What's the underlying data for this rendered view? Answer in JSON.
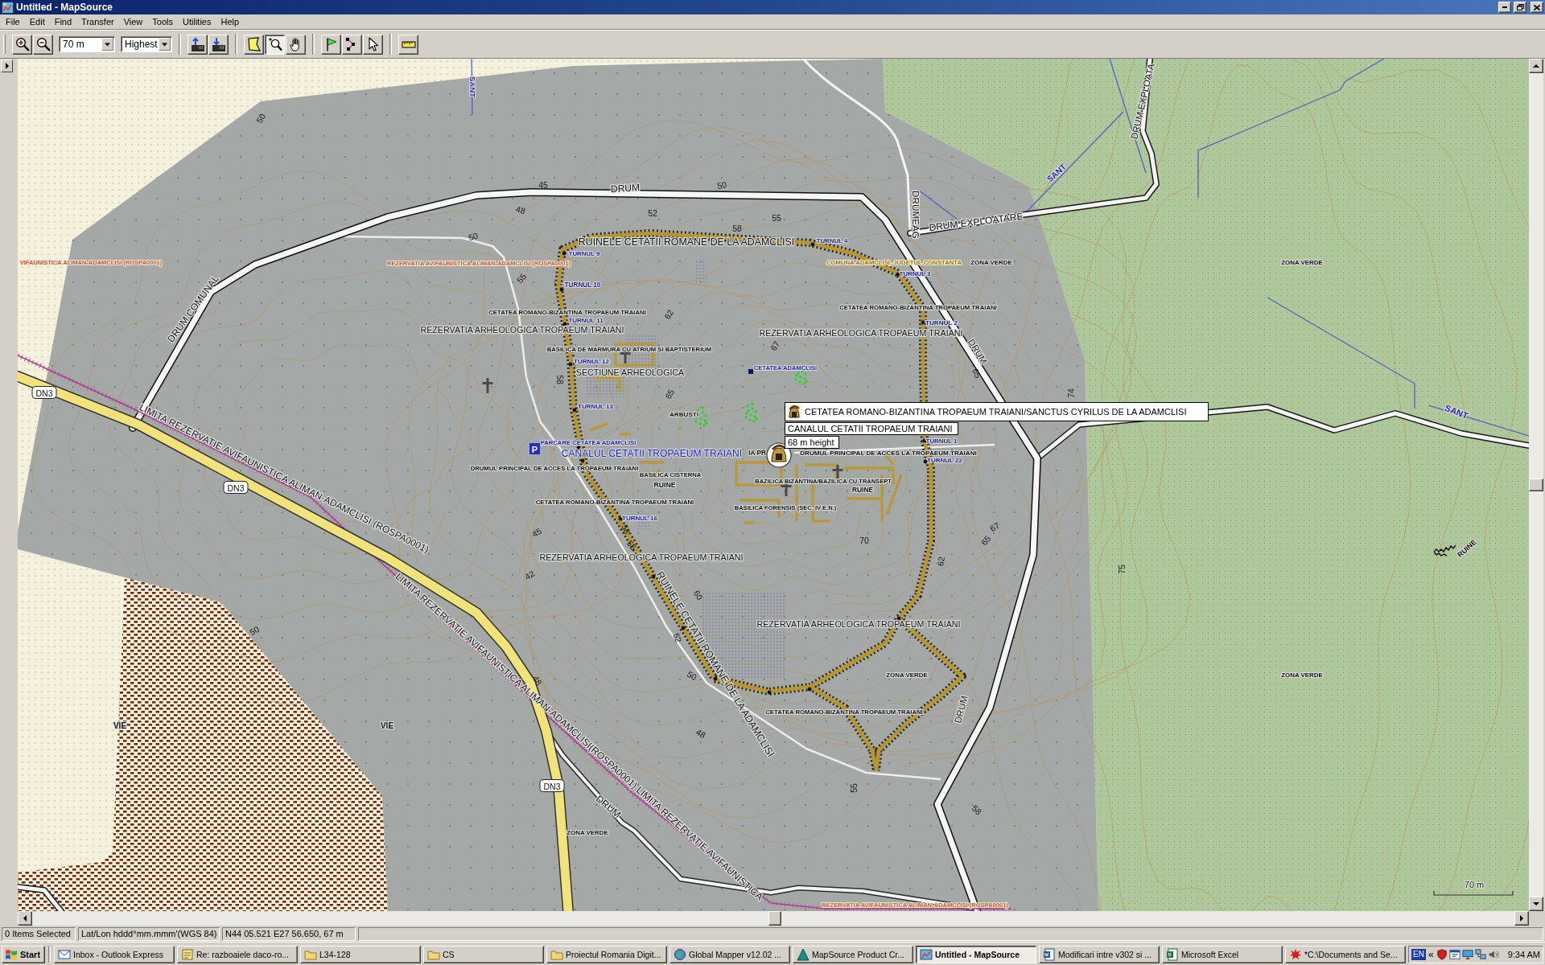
{
  "window": {
    "title": "Untitled - MapSource"
  },
  "menu": [
    "File",
    "Edit",
    "Find",
    "Transfer",
    "View",
    "Tools",
    "Utilities",
    "Help"
  ],
  "toolbar": {
    "zoom_buttons": [
      {
        "kind": "zoom-in"
      },
      {
        "kind": "zoom-out"
      }
    ],
    "scale": "70 m",
    "detail": "Highest",
    "tool_groups": [
      [
        {
          "kind": "receive"
        },
        {
          "kind": "send"
        }
      ],
      [
        {
          "kind": "map-select",
          "selected": false
        },
        {
          "kind": "zoom",
          "selected": true
        },
        {
          "kind": "pan",
          "selected": false
        }
      ],
      [
        {
          "kind": "waypoint",
          "selected": false
        },
        {
          "kind": "route",
          "selected": false
        },
        {
          "kind": "select",
          "selected": false
        }
      ],
      [
        {
          "kind": "measure",
          "selected": false
        }
      ]
    ]
  },
  "map": {
    "labels": [
      {
        "text": "SANT",
        "kind": "water"
      },
      {
        "text": "DRUM EXPLOATA",
        "kind": "road"
      },
      {
        "text": "50",
        "kind": "contour"
      },
      {
        "text": "SANT",
        "kind": "water"
      },
      {
        "text": "45",
        "kind": "contour"
      },
      {
        "text": "DRUM",
        "kind": "road"
      },
      {
        "text": "50",
        "kind": "contour"
      },
      {
        "text": "48",
        "kind": "contour"
      },
      {
        "text": "52",
        "kind": "contour"
      },
      {
        "text": "55",
        "kind": "contour"
      },
      {
        "text": "DRUMEAG",
        "kind": "road"
      },
      {
        "text": "DRUM EXPLOATARE",
        "kind": "road"
      },
      {
        "text": "58",
        "kind": "contour"
      },
      {
        "text": "50",
        "kind": "contour"
      },
      {
        "text": "RUINELE CETATII ROMANE DE LA ADAMCLISI",
        "kind": "big"
      },
      {
        "text": "TURNUL 4",
        "kind": "tower"
      },
      {
        "text": "TURNUL 9",
        "kind": "tower"
      },
      {
        "text": "VIFAUNISTICA ALIMAN-ADAMCLISI (ROSPA0001)",
        "kind": "reserve"
      },
      {
        "text": "REZERVATIA AVIFAUNISTICA ALIMAN-ADAMCLISI (ROSPA0001)",
        "kind": "reserve"
      },
      {
        "text": "COMUNA ADAMCLISI, JUDETUL CONSTANTA",
        "kind": "commune"
      },
      {
        "text": "ZONA VERDE",
        "kind": "small"
      },
      {
        "text": "ZONA VERDE",
        "kind": "small"
      },
      {
        "text": "TURNUL 3",
        "kind": "tower"
      },
      {
        "text": "55",
        "kind": "contour"
      },
      {
        "text": "TURNUL 10",
        "kind": "tower"
      },
      {
        "text": "DRUM COMUNAL",
        "kind": "road"
      },
      {
        "text": "CETATEA ROMANO-BIZANTINA TROPAEUM TRAIANI",
        "kind": "small"
      },
      {
        "text": "62",
        "kind": "contour"
      },
      {
        "text": "CETATEA ROMANO-BIZANTINA TROPAEUM TRAIANI",
        "kind": "small"
      },
      {
        "text": "TURNUL 11",
        "kind": "tower"
      },
      {
        "text": "TURNUL 2",
        "kind": "tower"
      },
      {
        "text": "REZERVATIA ARHEOLOGICA TROPAEUM TRAIANI",
        "kind": "big"
      },
      {
        "text": "REZERVATIA ARHEOLOGICA TROPAEUM TRAIANI",
        "kind": "big"
      },
      {
        "text": "BASILICA DE MARMURA CU ATRIUM SI BAPTISTERIUM",
        "kind": "small"
      },
      {
        "text": "67",
        "kind": "contour"
      },
      {
        "text": "DRUM",
        "kind": "road"
      },
      {
        "text": "TURNUL 12",
        "kind": "tower"
      },
      {
        "text": "SECTIUNE ARHEOLOGICA",
        "kind": "big"
      },
      {
        "text": "CETATEA ADAMCLISI",
        "kind": "water"
      },
      {
        "text": "65",
        "kind": "contour"
      },
      {
        "text": "58",
        "kind": "contour"
      },
      {
        "text": "DN3",
        "kind": "shield"
      },
      {
        "text": "65",
        "kind": "contour"
      },
      {
        "text": "74",
        "kind": "contour"
      },
      {
        "text": "TURNUL 13",
        "kind": "tower"
      },
      {
        "text": "ARBUSTI",
        "kind": "small"
      },
      {
        "text": "SANT",
        "kind": "water"
      },
      {
        "text": "PARCARE CETATEA ADAMCLISI",
        "kind": "water"
      },
      {
        "text": "TURNUL 1",
        "kind": "tower"
      },
      {
        "text": "CANALUL CETATII TROPAEUM TRAIANI",
        "kind": "canal"
      },
      {
        "text": "IA PR",
        "kind": "small"
      },
      {
        "text": "DRUMUL PRINCIPAL DE ACCES LA TROPAEUM TRAIANI",
        "kind": "small"
      },
      {
        "text": "TURNUL 22",
        "kind": "tower"
      },
      {
        "text": "DRUMUL PRINCIPAL DE ACCES LA TROPAEUM TRAIANI",
        "kind": "small"
      },
      {
        "text": "BASILICA CISTERNA",
        "kind": "small"
      },
      {
        "text": "LIMITA REZERVATIE AVIFAUNISTICA ALIMAN-ADAMCLISI (ROSPA0001)",
        "kind": "limit"
      },
      {
        "text": "BAZILICA BIZANTINA/BAZILICA CU TRANSEPT",
        "kind": "small"
      },
      {
        "text": "DN3",
        "kind": "shield"
      },
      {
        "text": "RUINE",
        "kind": "small"
      },
      {
        "text": "RUINE",
        "kind": "small"
      },
      {
        "text": "CETATEA ROMANO-BIZANTINA TROPAEUM TRAIANI",
        "kind": "small"
      },
      {
        "text": "BASILICA FORENSIS (SEC. IV E.N.)",
        "kind": "small"
      },
      {
        "text": "TURNUL 16",
        "kind": "tower"
      },
      {
        "text": "45",
        "kind": "contour"
      },
      {
        "text": "58",
        "kind": "contour"
      },
      {
        "text": "67",
        "kind": "contour"
      },
      {
        "text": "55",
        "kind": "contour"
      },
      {
        "text": "70",
        "kind": "contour"
      },
      {
        "text": "65",
        "kind": "contour"
      },
      {
        "text": "RUINE",
        "kind": "small"
      },
      {
        "text": "REZERVATIA ARHEOLOGICA TROPAEUM TRAIANI",
        "kind": "big"
      },
      {
        "text": "62",
        "kind": "contour"
      },
      {
        "text": "75",
        "kind": "contour"
      },
      {
        "text": "42",
        "kind": "contour"
      },
      {
        "text": "60",
        "kind": "contour"
      },
      {
        "text": "REZERVATIA ARHEOLOGICA TROPAEUM TRAIANI",
        "kind": "big"
      },
      {
        "text": "50",
        "kind": "contour"
      },
      {
        "text": "52",
        "kind": "contour"
      },
      {
        "text": "RUINELE CETATII ROMANE DE LA ADAMCLISI",
        "kind": "big"
      },
      {
        "text": "48",
        "kind": "contour"
      },
      {
        "text": "50",
        "kind": "contour"
      },
      {
        "text": "ZONA VERDE",
        "kind": "small"
      },
      {
        "text": "ZONA VERDE",
        "kind": "small"
      },
      {
        "text": "CETATEA ROMANO-BIZANTINA TROPAEUM TRAIANI",
        "kind": "small"
      },
      {
        "text": "DRUM",
        "kind": "road"
      },
      {
        "text": "VIE",
        "kind": "small"
      },
      {
        "text": "VIE",
        "kind": "small"
      },
      {
        "text": "LIMITA REZERVATIE AVIFAUNISTICA ALIMAN-ADAMCLISI(ROSPA0001) LIMITA REZERVATIE AVIFAUNISTICA",
        "kind": "limit"
      },
      {
        "text": "48",
        "kind": "contour"
      },
      {
        "text": "DN3",
        "kind": "shield"
      },
      {
        "text": "55",
        "kind": "contour"
      },
      {
        "text": "DRUM",
        "kind": "road"
      },
      {
        "text": "58",
        "kind": "contour"
      },
      {
        "text": "ZONA VERDE",
        "kind": "small"
      },
      {
        "text": "REZERVATIA AVIFAUNISTICA ALIMAN-ADAMCLISI (ROSPA0001)",
        "kind": "reserve"
      }
    ],
    "parking_sign": "P",
    "callout": {
      "title": "CETATEA ROMANO-BIZANTINA TROPAEUM TRAIANI/SANCTUS CYRILUS DE LA ADAMCLISI",
      "name": "CANALUL CETATII TROPAEUM TRAIANI",
      "note": "68 m height"
    },
    "scale_label": "70 m"
  },
  "status_bar": [
    "0 Items Selected",
    "Lat/Lon hddd°mm.mmm'(WGS 84)",
    "N44 05.521 E27 56.650, 67 m"
  ],
  "taskbar": {
    "start": "Start",
    "buttons": [
      {
        "label": "Inbox - Outlook Express",
        "kind": "mail",
        "selected": false
      },
      {
        "label": "Re: razboaiele daco-ro...",
        "kind": "note",
        "selected": false
      },
      {
        "label": "L34-128",
        "kind": "folder",
        "selected": false
      },
      {
        "label": "CS",
        "kind": "folder",
        "selected": false
      },
      {
        "label": "Proiectul Romania Digit...",
        "kind": "folder",
        "selected": false
      },
      {
        "label": "Global Mapper v12.02 ...",
        "kind": "globe",
        "selected": false
      },
      {
        "label": "MapSource Product Cr...",
        "kind": "triangle",
        "selected": false
      },
      {
        "label": "Untitled - MapSource",
        "kind": "map",
        "selected": true
      },
      {
        "label": "Modificari intre v302 si ...",
        "kind": "word",
        "selected": false
      },
      {
        "label": "Microsoft Excel",
        "kind": "excel",
        "selected": false
      },
      {
        "label": "*C:\\Documents and Se...",
        "kind": "splat",
        "selected": false
      }
    ],
    "tray": {
      "language": "EN",
      "expand": "«",
      "time": "9:34 AM"
    }
  }
}
